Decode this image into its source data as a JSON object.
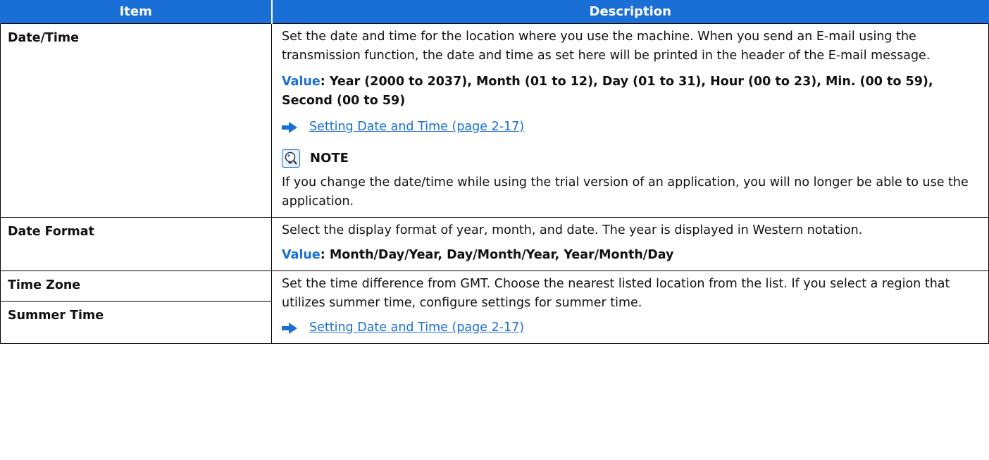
{
  "header": {
    "item": "Item",
    "description": "Description"
  },
  "rows": {
    "datetime": {
      "item": "Date/Time",
      "desc": "Set the date and time for the location where you use the machine. When you send an E-mail using the transmission function, the date and time as set here will be printed in the header of the E-mail message.",
      "value_label": "Value",
      "value_text": ": Year (2000 to 2037), Month (01 to 12), Day (01 to 31), Hour (00 to 23), Min. (00 to 59), Second (00 to 59)",
      "link": "Setting Date and Time (page 2-17)",
      "note_title": "NOTE",
      "note_text": "If you change the date/time while using the trial version of an application, you will no longer be able to use the application."
    },
    "dateformat": {
      "item": "Date Format",
      "desc": "Select the display format of year, month, and date. The year is displayed in Western notation.",
      "value_label": "Value",
      "value_text": ": Month/Day/Year, Day/Month/Year, Year/Month/Day"
    },
    "timezone": {
      "item": "Time Zone",
      "item2": "Summer Time",
      "desc": "Set the time difference from GMT. Choose the nearest listed location from the list. If you select a region that utilizes summer time, configure settings for summer time.",
      "link": "Setting Date and Time (page 2-17)"
    }
  },
  "colors": {
    "accent": "#1a6fd6"
  },
  "icons": {
    "arrow": "right-arrow-icon",
    "note": "note-icon"
  }
}
